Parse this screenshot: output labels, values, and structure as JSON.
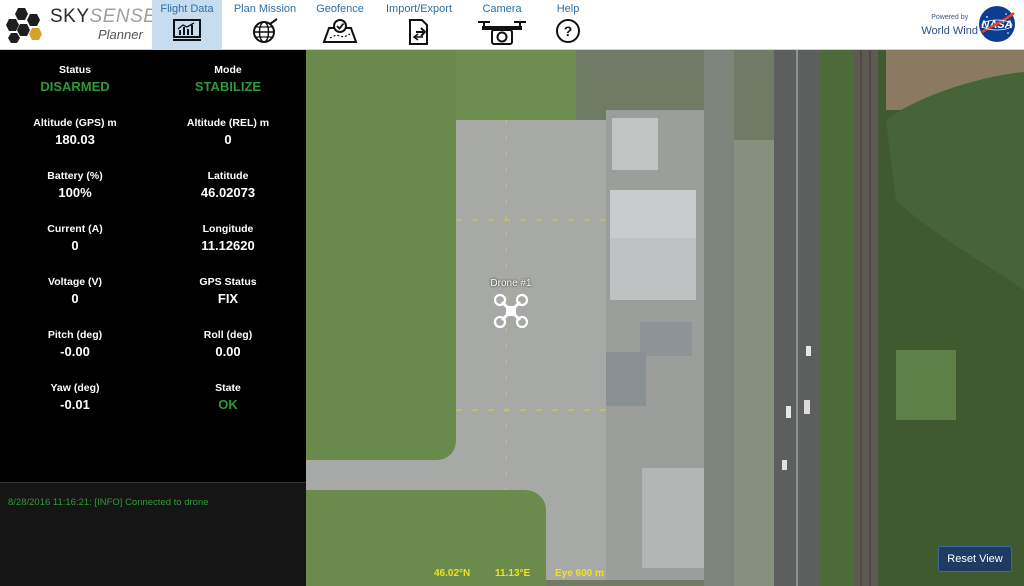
{
  "brand": {
    "sky": "SKY",
    "sense": "SENSE",
    "sub": "Planner"
  },
  "nav": [
    {
      "label": "Flight Data",
      "icon": "chart-icon",
      "active": true
    },
    {
      "label": "Plan Mission",
      "icon": "globe-icon",
      "active": false
    },
    {
      "label": "Geofence",
      "icon": "geofence-icon",
      "active": false
    },
    {
      "label": "Import/Export",
      "icon": "import-export-icon",
      "active": false
    },
    {
      "label": "Camera",
      "icon": "camera-drone-icon",
      "active": false
    },
    {
      "label": "Help",
      "icon": "help-icon",
      "active": false
    }
  ],
  "powered": {
    "line1": "Powered by",
    "line2": "World Wind"
  },
  "stats": {
    "status": {
      "title": "Status",
      "value": "DISARMED"
    },
    "mode": {
      "title": "Mode",
      "value": "STABILIZE"
    },
    "alt_gps": {
      "title": "Altitude (GPS) m",
      "value": "180.03"
    },
    "alt_rel": {
      "title": "Altitude (REL) m",
      "value": "0"
    },
    "battery": {
      "title": "Battery (%)",
      "value": "100%"
    },
    "latitude": {
      "title": "Latitude",
      "value": "46.02073"
    },
    "current": {
      "title": "Current (A)",
      "value": "0"
    },
    "longitude": {
      "title": "Longitude",
      "value": "11.12620"
    },
    "voltage": {
      "title": "Voltage (V)",
      "value": "0"
    },
    "gps_status": {
      "title": "GPS Status",
      "value": "FIX"
    },
    "pitch": {
      "title": "Pitch (deg)",
      "value": "-0.00"
    },
    "roll": {
      "title": "Roll (deg)",
      "value": "0.00"
    },
    "yaw": {
      "title": "Yaw (deg)",
      "value": "-0.01"
    },
    "state": {
      "title": "State",
      "value": "OK"
    }
  },
  "console": {
    "message": "8/28/2016 11:16:21: [INFO] Connected to drone"
  },
  "map": {
    "drone_label": "Drone #1",
    "lat_readout": "46.02°N",
    "lon_readout": "11.13°E",
    "eye_readout": "Eye  600 m",
    "reset_label": "Reset View"
  },
  "colors": {
    "accent": "#2c6ea8",
    "status_green": "#2e9a3a",
    "nav_active": "#c6dcef",
    "coords_yellow": "#f2e21d"
  }
}
